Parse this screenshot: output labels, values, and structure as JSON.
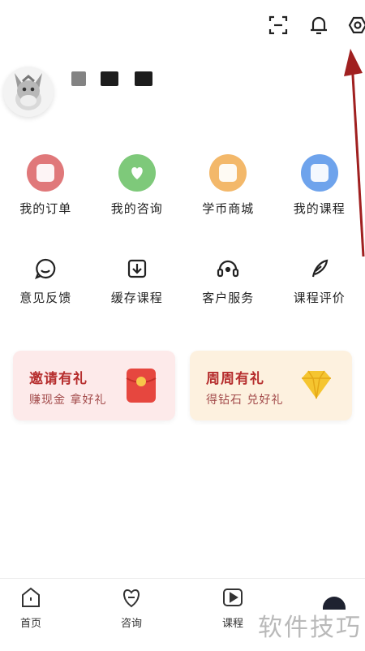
{
  "header": {
    "icons": [
      "scan-icon",
      "bell-icon",
      "settings-icon"
    ]
  },
  "profile": {
    "avatar": "donkey-avatar"
  },
  "primary_actions": [
    {
      "label": "我的订单",
      "icon": "order-icon",
      "color": "#e0787a"
    },
    {
      "label": "我的咨询",
      "icon": "consult-heart-icon",
      "color": "#7ec97a"
    },
    {
      "label": "学币商城",
      "icon": "coin-mall-icon",
      "color": "#f3b86a"
    },
    {
      "label": "我的课程",
      "icon": "course-icon",
      "color": "#6ea3ec"
    }
  ],
  "secondary_actions": [
    {
      "label": "意见反馈",
      "icon": "feedback-icon"
    },
    {
      "label": "缓存课程",
      "icon": "download-icon"
    },
    {
      "label": "客户服务",
      "icon": "headset-icon"
    },
    {
      "label": "课程评价",
      "icon": "feather-icon"
    }
  ],
  "promos": [
    {
      "title": "邀请有礼",
      "subtitle": "赚现金 拿好礼",
      "icon": "red-envelope-icon",
      "bg": "#fdeaea"
    },
    {
      "title": "周周有礼",
      "subtitle": "得钻石 兑好礼",
      "icon": "diamond-icon",
      "bg": "#fdf1df"
    }
  ],
  "bottom_nav": [
    {
      "label": "首页",
      "icon": "home-icon"
    },
    {
      "label": "咨询",
      "icon": "heart-chat-icon"
    },
    {
      "label": "课程",
      "icon": "play-icon"
    },
    {
      "label": "",
      "icon": "profile-tab-icon"
    }
  ],
  "watermark": "软件技巧",
  "colors": {
    "accent": "#b62e2e",
    "arrow": "#a02020"
  }
}
